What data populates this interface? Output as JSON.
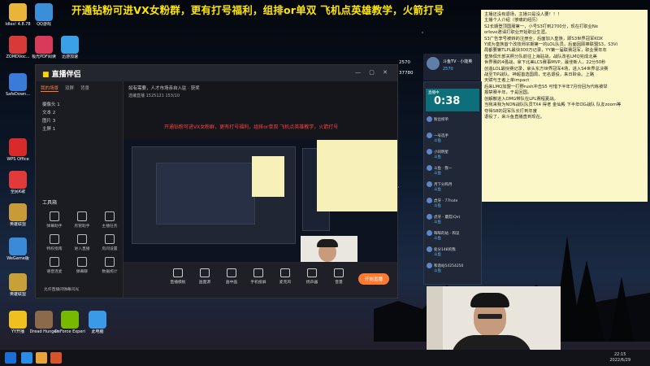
{
  "banner": "开通钻粉可进VX女粉群，更有打号福利，组排or单双 飞机点英雄教学，火箭打号",
  "desktop_icons": [
    {
      "label": "Idles! 4.8.78",
      "name": "idles-app-icon",
      "color": "#e8b53a"
    },
    {
      "label": "QQ游戏",
      "name": "qq-game-icon",
      "color": "#3a8fd8"
    },
    {
      "label": "ZOMDVoc...",
      "name": "zomdvoc-icon",
      "color": "#d83a3a"
    },
    {
      "label": "极光PDF阅读",
      "name": "pdf-reader-icon",
      "color": "#d83a5a"
    },
    {
      "label": "迅游加速",
      "name": "accelerator-icon",
      "color": "#3aa0e8"
    },
    {
      "label": "SafeDown...",
      "name": "safedown-icon",
      "color": "#3a7ad8"
    },
    {
      "label": "腾讯会议",
      "name": "tencent-meeting-icon",
      "color": "#3a6ad8"
    },
    {
      "label": "WPS Office",
      "name": "wps-office-icon",
      "color": "#d82a2a"
    },
    {
      "label": "全民K歌",
      "name": "kge-icon",
      "color": "#e03a3a"
    },
    {
      "label": "Leve...",
      "name": "leve-icon",
      "color": "#3a8ae8"
    },
    {
      "label": "英雄联盟",
      "name": "lol-icon",
      "color": "#c89a3a"
    },
    {
      "label": "WeGame版",
      "name": "wegame-icon",
      "color": "#3a8ad8"
    },
    {
      "label": "英雄联盟",
      "name": "lol-icon-2",
      "color": "#c8a03a"
    },
    {
      "label": "YY开播",
      "name": "yy-live-icon",
      "color": "#f0c020"
    },
    {
      "label": "Dread Hunger",
      "name": "dread-hunger-icon",
      "color": "#8a6a4a"
    },
    {
      "label": "GeForce Experience",
      "name": "geforce-icon",
      "color": "#76b900"
    },
    {
      "label": "此电脑",
      "name": "this-pc-icon",
      "color": "#3a9ae8"
    }
  ],
  "notes": [
    "主播还没有退场，主播只是没人要！！！",
    "主播个人介绍（惨痛的经历）",
    "S2长期登顶国服第一，小号S3打到2700分，现在打职业Ne",
    "orlove邀请打职业开始职业生涯。",
    "S3广告李号被转的注册全，后面加入皇族，即S3世界冠军KOX",
    "Y成为皇族首个改技师宗期第一的LOL队员，后面因顾捧联盟S3，S3Vi",
    "局都要第TLPL最快300万记录，YY第一届联赛冠军，职业赛年年",
    "皇族俱乐部关照分队前往上海驻战，战队改名LMQ完成北美",
    "世界赛的4强战，拿下北美LCS赛事MVP，最佳新人，22分50秒",
    "创造LOL最快赛记录，拿头东方世界冠军4场，进入S4世界总决赛",
    "战至TIP战队。神超首选国局，无名退役，来日聆会。上路",
    "天赋与王者上单impact",
    "后来LMQ加盟一打野rush冲击S5 可惜下半年7月份回为代练被举",
    "报禁赛半年，于是回国。",
    "创解散进入OMG带队在LPL赛程夏战。",
    "当我来我为NON战队队员TX4 得老 金仙殿 下半年OG战队 队友zoom等",
    "夺得S8的冠军队长打到年度",
    "退役了，来斗鱼直播直到现在。"
  ],
  "app": {
    "logo_main": "直播伴侣",
    "logo_prefix": "",
    "tabs": [
      "我的场景",
      "双屏",
      "背景"
    ],
    "scenes": [
      "摄像头 1",
      "文本 2",
      "图片 3",
      "主屏 1"
    ],
    "tools_title": "工具箱",
    "tools": [
      "弹幕助手",
      "房管助手",
      "主播任务",
      "特权指南",
      "进入直播",
      "房间设置",
      "语音连麦",
      "弹幕聊",
      "数据统计"
    ],
    "topbar": "如有需要，人才市场亲自入驻 ·  获奖",
    "topbar2": "选编直播  1525121  153/10",
    "red_text": "开通钻粉可进VX女粉群，更有打号福利，组排or单双 飞机点英雄教学，火箭打号",
    "bottom_tools": [
      "直播模板",
      "画面源",
      "画中画",
      "手机投屏",
      "麦克风",
      "扬声器",
      "音量"
    ],
    "live_button": "开始直播",
    "footer_hint": "允许直播间弹幕闪光"
  },
  "stream": {
    "title": "斗鱼TV · 小能英",
    "timer": "0:38",
    "timer_label": "直播中",
    "count1": "2570",
    "count2": "37780"
  },
  "chat": [
    {
      "name": "粉丝榜单",
      "sub": ""
    },
    {
      "name": "一号选手",
      "sub": "斗鱼"
    },
    {
      "name": "小同明星",
      "sub": "斗鱼"
    },
    {
      "name": "斗鱼 · 我一",
      "sub": "斗鱼"
    },
    {
      "name": "月下分和月",
      "sub": "斗鱼"
    },
    {
      "name": "虎牙 - 77hate",
      "sub": "斗鱼"
    },
    {
      "name": "虎牙 - 蘑菇(Qe)",
      "sub": "斗鱼"
    },
    {
      "name": "晖晖的站 - 和议",
      "sub": "斗鱼"
    },
    {
      "name": "处分148的我",
      "sub": "斗鱼"
    },
    {
      "name": "和谐站54254250",
      "sub": "斗鱼"
    }
  ],
  "clock": {
    "time": "22:15",
    "date": "2022/6/29"
  }
}
